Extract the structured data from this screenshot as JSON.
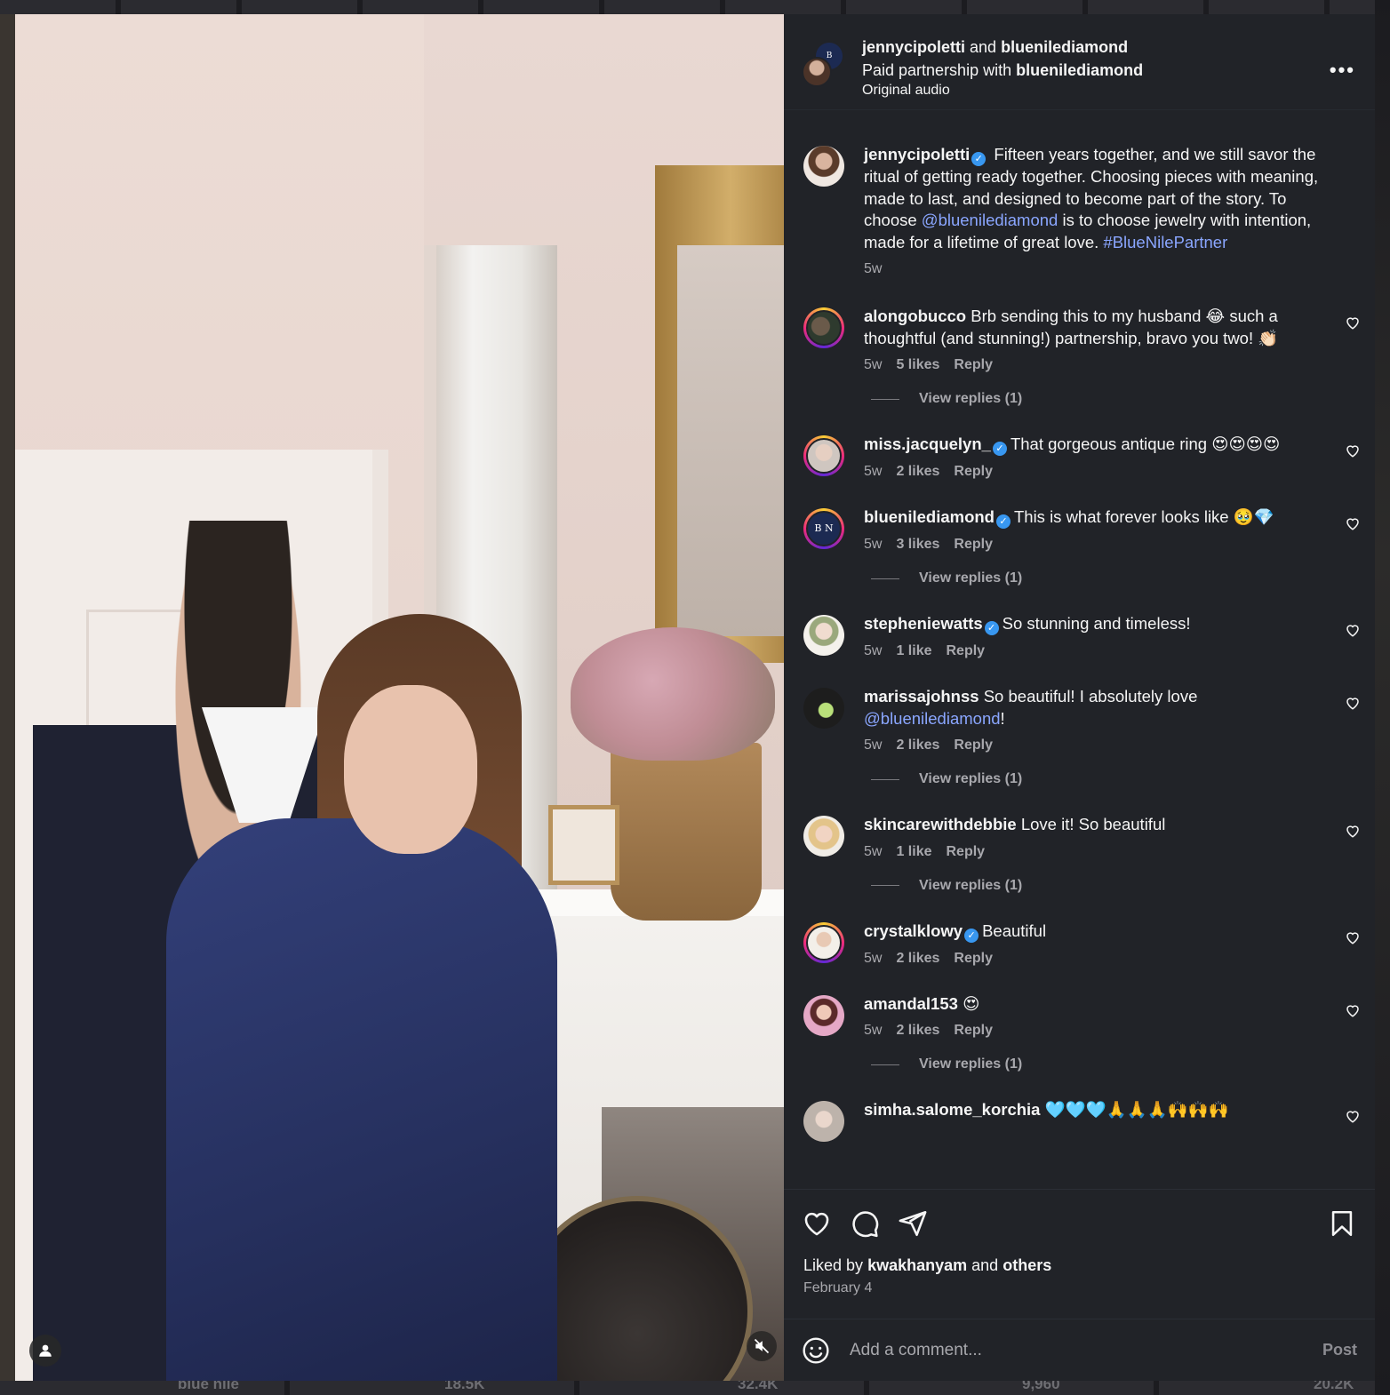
{
  "background": {
    "stats": [
      "18.5K",
      "32.4K",
      "9,960",
      "20.2K"
    ],
    "bottom_caption": "blue nile"
  },
  "post": {
    "header": {
      "author1": "jennycipoletti",
      "and_word": "and",
      "author2": "bluenilediamond",
      "partnership_prefix": "Paid partnership with",
      "partner": "bluenilediamond",
      "audio": "Original audio"
    },
    "caption": {
      "username": "jennycipoletti",
      "text_part1": "Fifteen years together, and we still savor the ritual of getting ready together. Choosing pieces with meaning, made to last, and designed to become part of the story. To choose ",
      "mention": "@bluenilediamond",
      "text_part2": " is to choose jewelry with intention, made for a lifetime of great love. ",
      "hashtag": "#BlueNilePartner",
      "time": "5w"
    },
    "comments": [
      {
        "username": "alongobucco",
        "verified": false,
        "text": "Brb sending this to my husband 😂 such a thoughtful (and stunning!) partnership, bravo you two! 👏🏻",
        "time": "5w",
        "likes": "5 likes",
        "reply": "Reply",
        "view_replies": "View replies (1)"
      },
      {
        "username": "miss.jacquelyn_",
        "verified": true,
        "text": "That gorgeous antique ring 😍😍😍😍",
        "time": "5w",
        "likes": "2 likes",
        "reply": "Reply"
      },
      {
        "username": "bluenilediamond",
        "verified": true,
        "text": "This is what forever looks like 🥹💎",
        "time": "5w",
        "likes": "3 likes",
        "reply": "Reply",
        "view_replies": "View replies (1)"
      },
      {
        "username": "stepheniewatts",
        "verified": true,
        "text": "So stunning and timeless!",
        "time": "5w",
        "likes": "1 like",
        "reply": "Reply"
      },
      {
        "username": "marissajohnss",
        "verified": false,
        "text_before": "So beautiful! I absolutely love ",
        "mention": "@bluenilediamond",
        "text_after": "!",
        "time": "5w",
        "likes": "2 likes",
        "reply": "Reply",
        "view_replies": "View replies (1)"
      },
      {
        "username": "skincarewithdebbie",
        "verified": false,
        "text": "Love it! So beautiful",
        "time": "5w",
        "likes": "1 like",
        "reply": "Reply",
        "view_replies": "View replies (1)"
      },
      {
        "username": "crystalklowy",
        "verified": true,
        "text": "Beautiful",
        "time": "5w",
        "likes": "2 likes",
        "reply": "Reply"
      },
      {
        "username": "amandal153",
        "verified": false,
        "text": "😍",
        "time": "5w",
        "likes": "2 likes",
        "reply": "Reply",
        "view_replies": "View replies (1)"
      },
      {
        "username": "simha.salome_korchia",
        "verified": false,
        "text": "🩵🩵🩵🙏🙏🙏🙌🙌🙌"
      }
    ],
    "liked_by_prefix": "Liked by",
    "liked_by_user": "kwakhanyam",
    "liked_by_and": "and",
    "liked_by_others": "others",
    "date": "February 4",
    "comment_placeholder": "Add a comment...",
    "post_label": "Post",
    "badge_letters": "B N"
  },
  "colors": {
    "panel_bg": "#212328",
    "link": "#8aa6ff",
    "verified": "#3897f0",
    "muted": "#a8a8ad"
  }
}
